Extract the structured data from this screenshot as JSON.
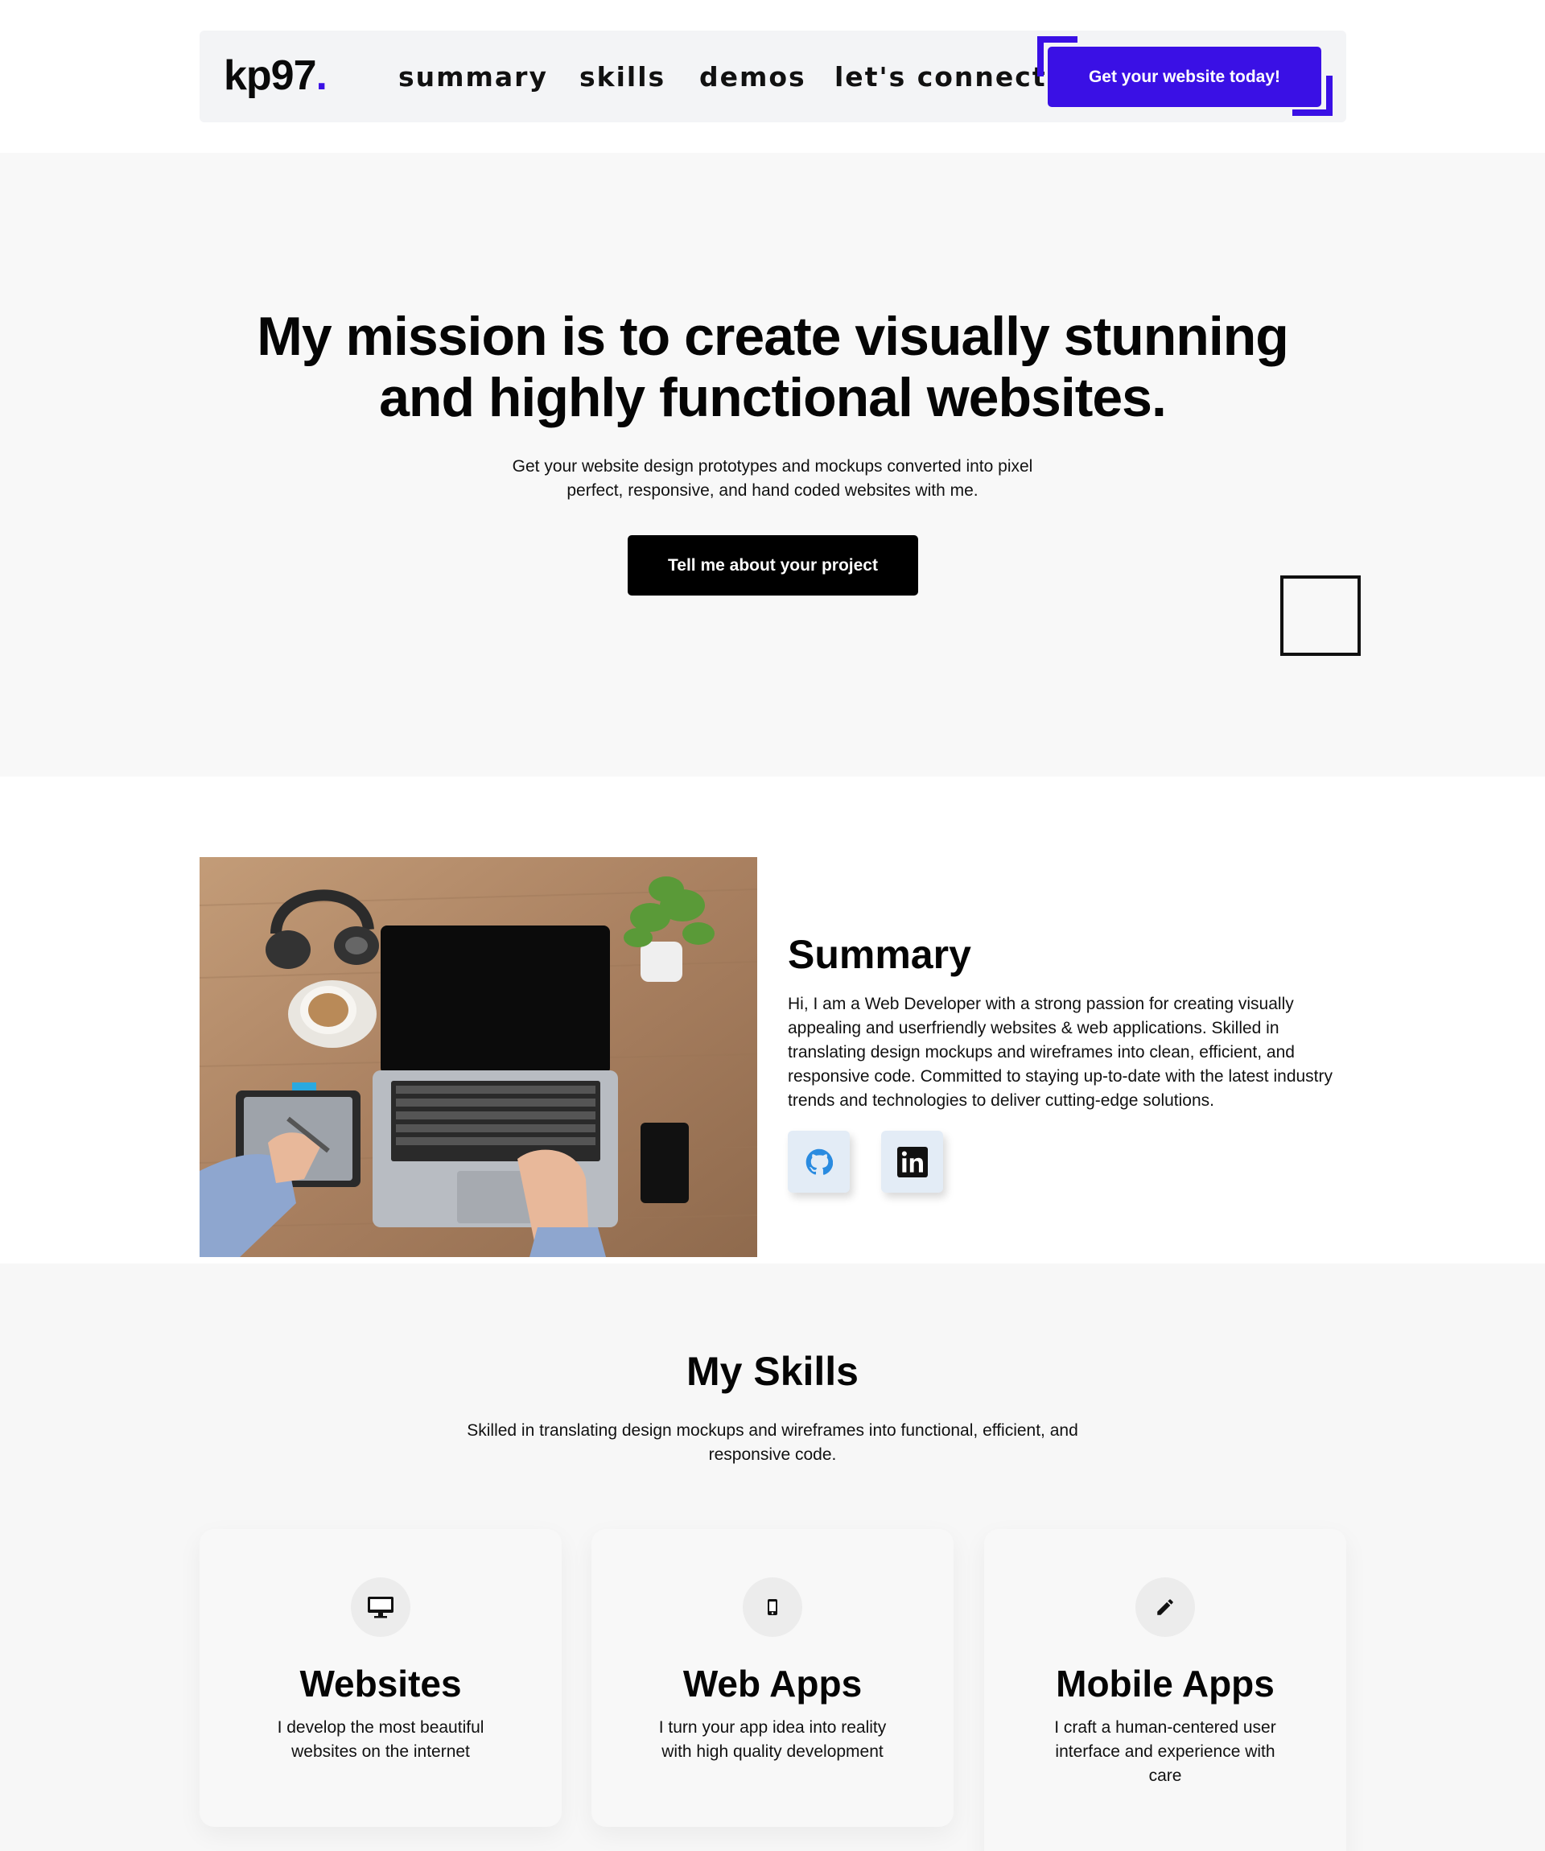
{
  "header": {
    "logo_text": "kp97",
    "logo_dot": ".",
    "nav": {
      "summary": "summary",
      "skills": "skills",
      "demos": "demos",
      "connect": "let's connect"
    },
    "cta_label": "Get your website today!"
  },
  "colors": {
    "accent": "#3a10e5",
    "hero_bg": "#f8f8f8",
    "dark_button": "#000000"
  },
  "hero": {
    "title_line1": "My mission is to create visually stunning",
    "title_line2": "and highly functional websites.",
    "subtitle_line1": "Get your website design prototypes and mockups converted into pixel",
    "subtitle_line2": "perfect, responsive, and hand coded websites with me.",
    "button_label": "Tell me about your project"
  },
  "summary": {
    "title": "Summary",
    "text": "Hi, I am a Web Developer with a strong passion for creating visually appealing and userfriendly websites & web applications. Skilled in translating design mockups and wireframes into clean, efficient, and responsive code. Committed to staying up-to-date with the latest industry trends and technologies to deliver cutting-edge solutions.",
    "social": [
      {
        "icon": "github-icon"
      },
      {
        "icon": "linkedin-icon"
      }
    ]
  },
  "skills": {
    "title": "My Skills",
    "subtitle_line1": "Skilled in translating design mockups and wireframes into functional, efficient, and",
    "subtitle_line2": "responsive code.",
    "cards": [
      {
        "icon": "monitor-icon",
        "title": "Websites",
        "text": "I develop the most beautiful websites on the internet"
      },
      {
        "icon": "mobile-icon",
        "title": "Web Apps",
        "text": "I turn your app idea into reality with high quality development"
      },
      {
        "icon": "pencil-icon",
        "title": "Mobile Apps",
        "text": "I craft a human-centered user interface and experience with care"
      }
    ]
  }
}
